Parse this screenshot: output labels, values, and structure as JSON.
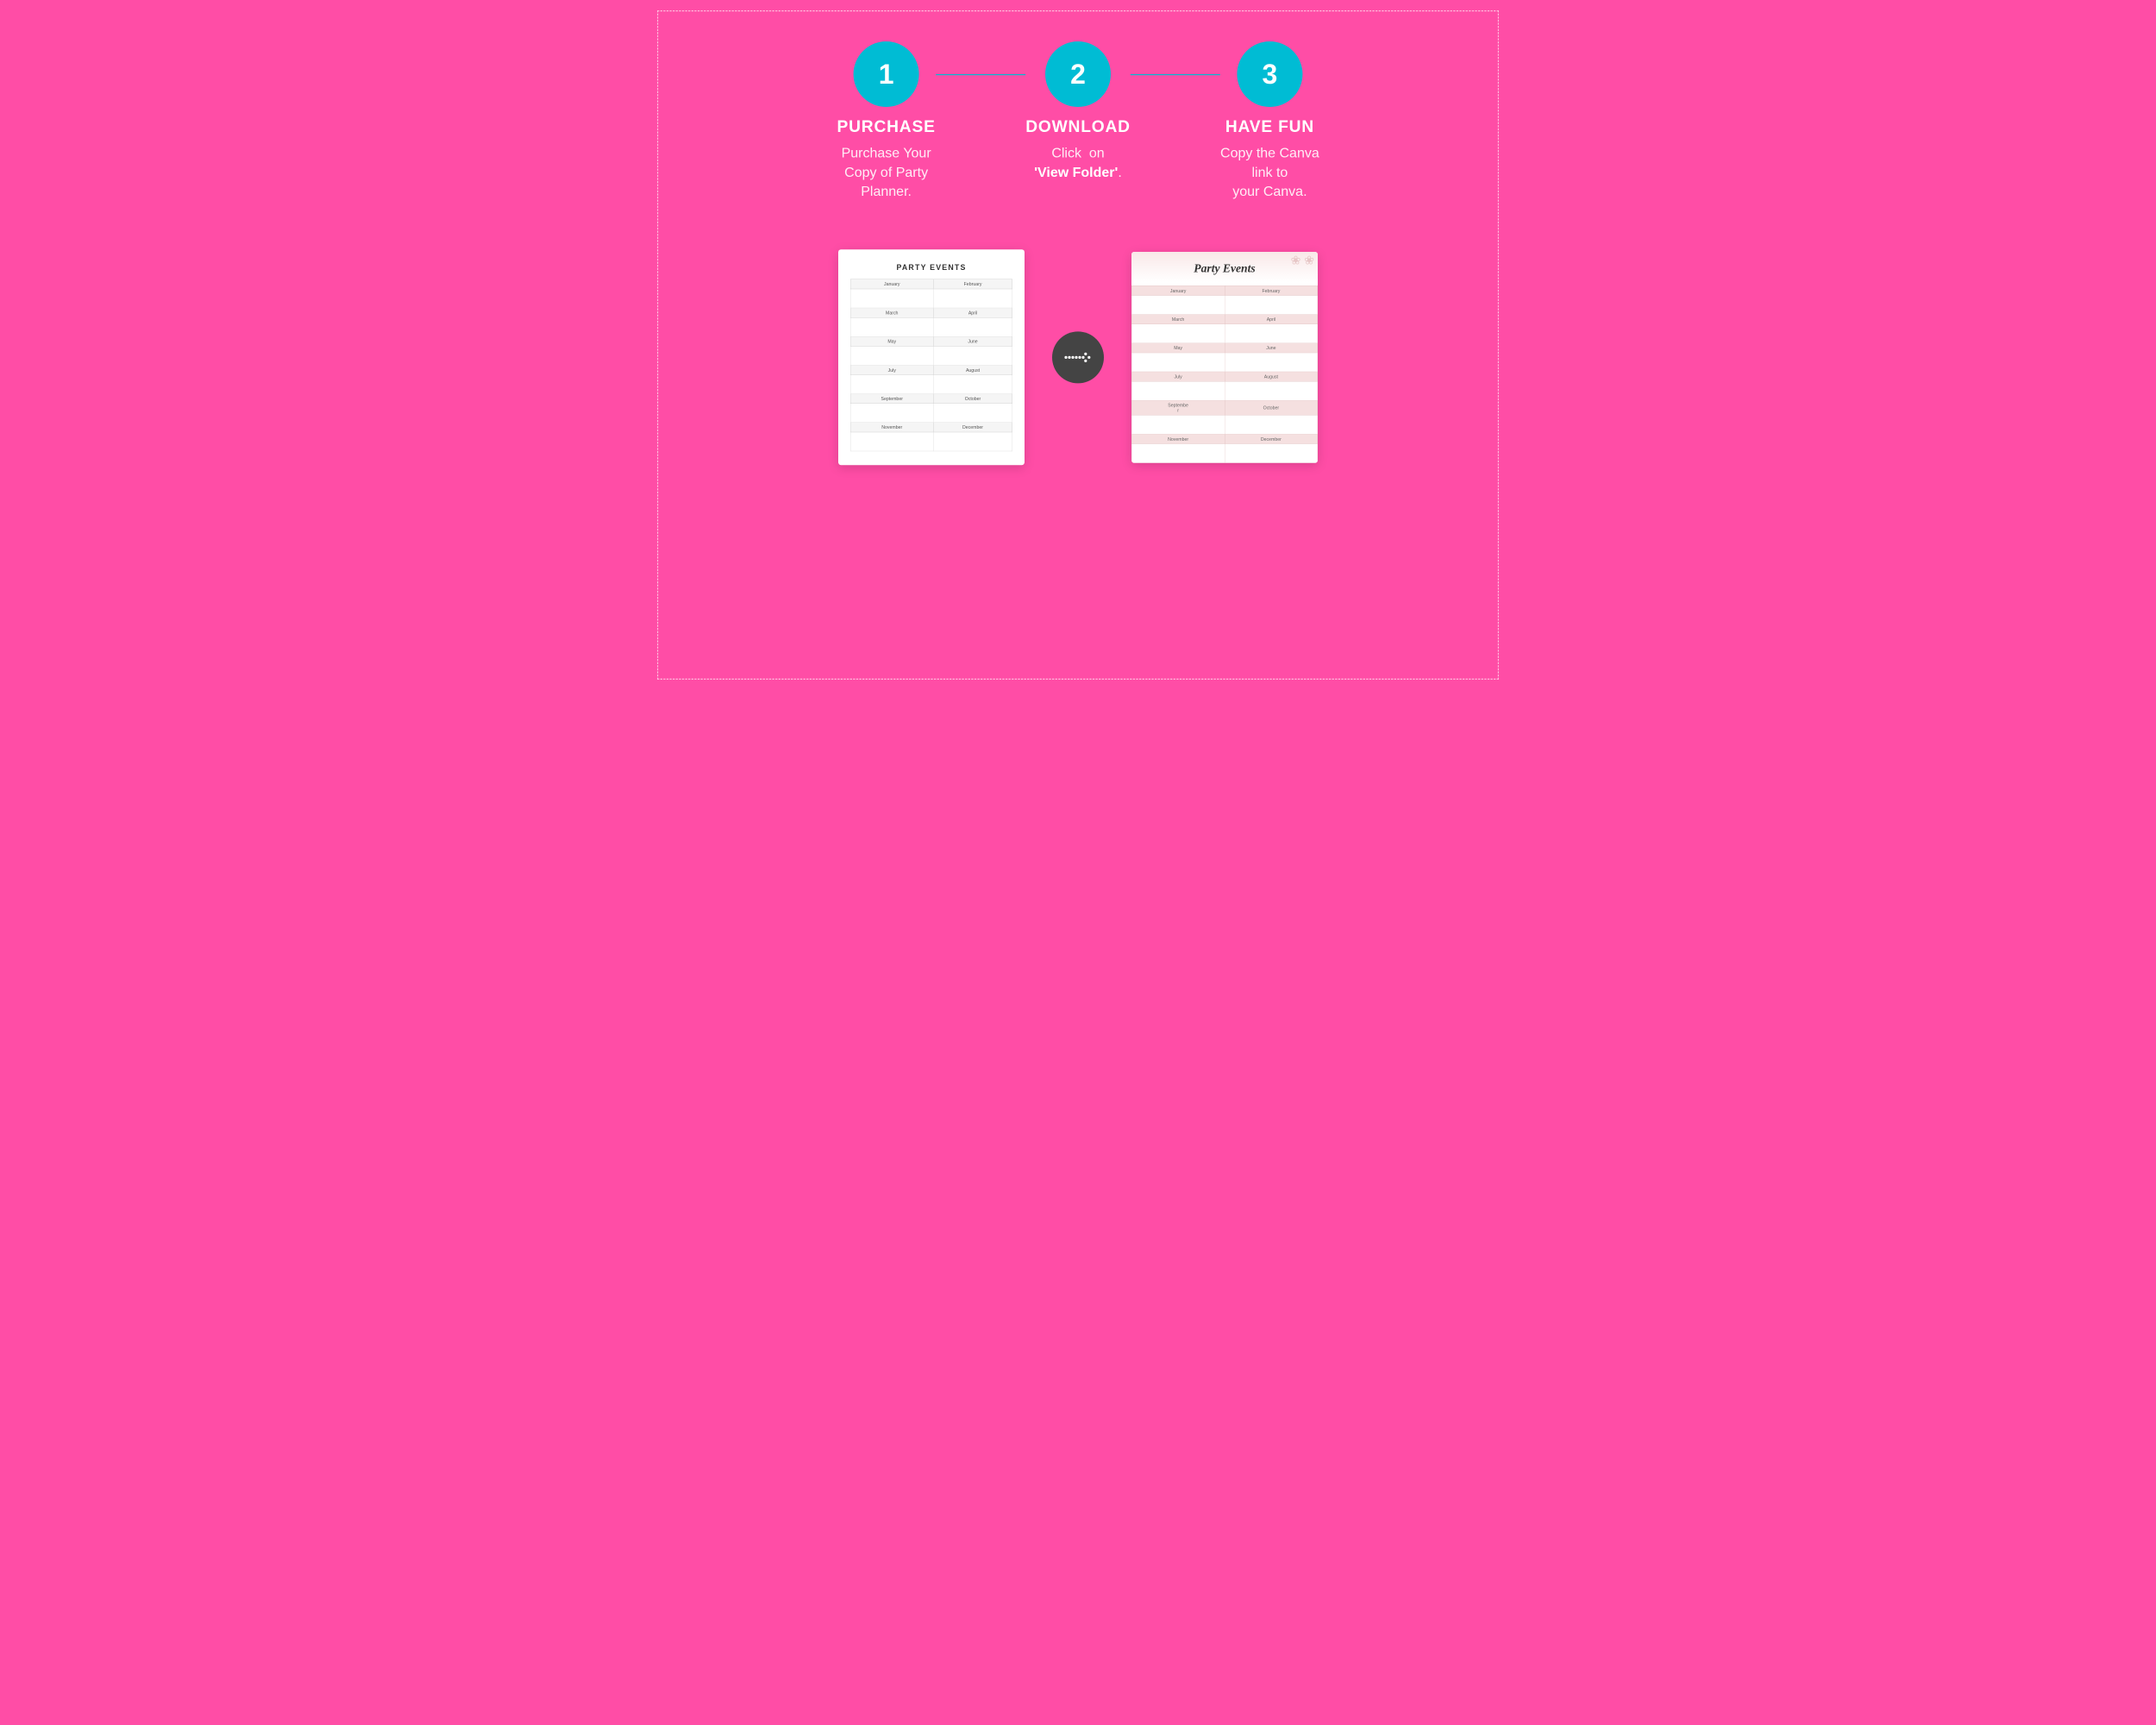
{
  "page": {
    "background_color": "#FF4DA6",
    "border_color": "rgba(255,255,255,0.6)"
  },
  "steps": [
    {
      "number": "1",
      "title": "PURCHASE",
      "description_lines": [
        "Purchase Your",
        "Copy of Party",
        "Planner."
      ],
      "bold_word": null
    },
    {
      "number": "2",
      "title": "DOWNLOAD",
      "description_plain": "Click  on ",
      "description_bold": "'View Folder'",
      "description_after": "."
    },
    {
      "number": "3",
      "title": "HAVE FUN",
      "description_lines": [
        "Copy the Canva",
        "link to",
        "your Canva."
      ],
      "bold_word": null
    }
  ],
  "plain_card": {
    "title": "PARTY EVENTS",
    "months": [
      [
        "January",
        "February"
      ],
      [
        "March",
        "April"
      ],
      [
        "May",
        "June"
      ],
      [
        "July",
        "August"
      ],
      [
        "September",
        "October"
      ],
      [
        "November",
        "December"
      ]
    ]
  },
  "styled_card": {
    "title": "Party Events",
    "months": [
      [
        "January",
        "February"
      ],
      [
        "March",
        "April"
      ],
      [
        "May",
        "June"
      ],
      [
        "July",
        "August"
      ],
      [
        "Septembe\nr",
        "October"
      ],
      [
        "November",
        "December"
      ]
    ]
  },
  "arrow": {
    "symbol": "⟫⟫⟫",
    "dots": "·······>"
  }
}
